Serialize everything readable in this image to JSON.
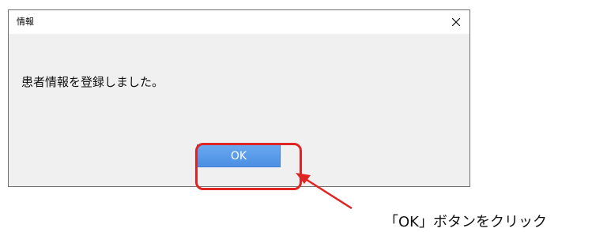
{
  "dialog": {
    "title": "情報",
    "message": "患者情報を登録しました。",
    "ok_label": "OK",
    "close_glyph": "×"
  },
  "annotation": {
    "caption": "「OK」ボタンをクリック",
    "highlight_color": "#e02424",
    "arrow_color": "#e02424"
  }
}
